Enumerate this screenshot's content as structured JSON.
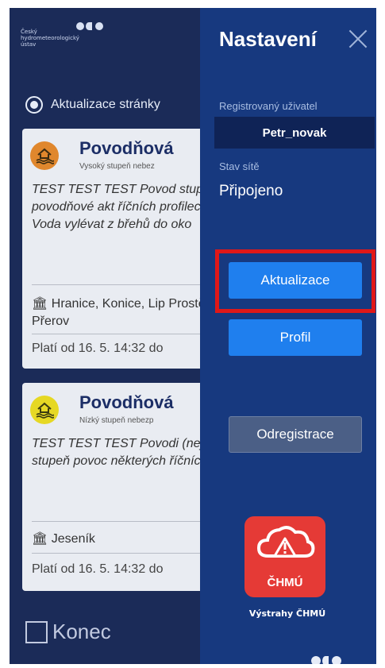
{
  "background_app": {
    "logo": {
      "lines": [
        "Český",
        "hydrometeorologický",
        "ústav"
      ]
    },
    "refresh_label": "Aktualizace stránky",
    "cards": [
      {
        "title": "Povodňová",
        "subtitle": "Vysoký stupeň nebez",
        "body": "TEST TEST TEST Povod stupeň povodňové akt říčních profilech. Voda vylévat z břehů do oko",
        "locations": "Hranice, Konice, Lip Prostějov, Přerov",
        "valid_from": "Platí od 16. 5. 14:32 do",
        "icon": "flood-icon",
        "color": "#e0872d"
      },
      {
        "title": "Povodňová",
        "subtitle": "Nízký stupeň nebezp",
        "body": "TEST TEST TEST Povodi (nejnižší) stupeň povoc některých říčních profi",
        "locations": "Jeseník",
        "valid_from": "Platí od 16. 5. 14:32 do",
        "icon": "flood-icon",
        "color": "#e6d824"
      }
    ],
    "exit_label": "Konec"
  },
  "settings_panel": {
    "title": "Nastavení",
    "registered_user_label": "Registrovaný uživatel",
    "registered_user_value": "Petr_novak",
    "network_status_label": "Stav sítě",
    "network_status_value": "Připojeno",
    "update_button": "Aktualizace",
    "profile_button": "Profil",
    "unregister_button": "Odregistrace",
    "warning_logo_text": "ČHMÚ",
    "warning_caption": "Výstrahy ČHMÚ"
  },
  "colors": {
    "panel_bg": "#17397f",
    "primary_button": "#1f7fee",
    "highlight_border": "#e01818",
    "warning_logo": "#e53a36"
  }
}
